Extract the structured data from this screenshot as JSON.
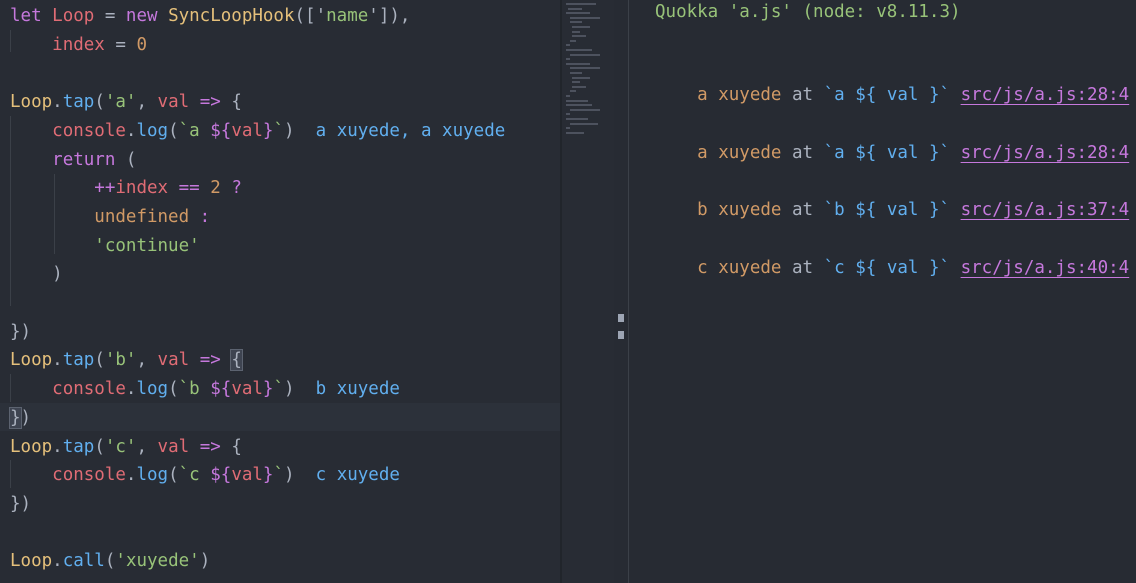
{
  "editor": {
    "lines": [
      {
        "tokens": [
          [
            "kw",
            "let "
          ],
          [
            "var",
            "Loop"
          ],
          [
            "plain",
            " = "
          ],
          [
            "kw",
            "new "
          ],
          [
            "cls",
            "SyncLoopHook"
          ],
          [
            "plain",
            "(['"
          ],
          [
            "str",
            "name"
          ],
          [
            "plain",
            "']),"
          ]
        ]
      },
      {
        "tokens": [
          [
            "plain",
            "    "
          ],
          [
            "var",
            "index"
          ],
          [
            "plain",
            " = "
          ],
          [
            "num",
            "0"
          ]
        ]
      },
      {
        "tokens": []
      },
      {
        "tokens": [
          [
            "cls",
            "Loop"
          ],
          [
            "plain",
            "."
          ],
          [
            "fn",
            "tap"
          ],
          [
            "plain",
            "("
          ],
          [
            "str",
            "'a'"
          ],
          [
            "plain",
            ", "
          ],
          [
            "var",
            "val"
          ],
          [
            "plain",
            " "
          ],
          [
            "op",
            "=>"
          ],
          [
            "plain",
            " {"
          ]
        ]
      },
      {
        "tokens": [
          [
            "plain",
            "    "
          ],
          [
            "var",
            "console"
          ],
          [
            "plain",
            "."
          ],
          [
            "fn",
            "log"
          ],
          [
            "plain",
            "("
          ],
          [
            "str",
            "`a "
          ],
          [
            "tpl",
            "${"
          ],
          [
            "tplvar",
            "val"
          ],
          [
            "tpl",
            "}"
          ],
          [
            "str",
            "`"
          ],
          [
            "plain",
            ")  "
          ],
          [
            "inline-out",
            "a xuyede, a xuyede"
          ]
        ]
      },
      {
        "tokens": [
          [
            "plain",
            "    "
          ],
          [
            "kw",
            "return"
          ],
          [
            "plain",
            " ("
          ]
        ]
      },
      {
        "tokens": [
          [
            "plain",
            "        "
          ],
          [
            "op",
            "++"
          ],
          [
            "var",
            "index"
          ],
          [
            "plain",
            " "
          ],
          [
            "op",
            "=="
          ],
          [
            "plain",
            " "
          ],
          [
            "num",
            "2"
          ],
          [
            "plain",
            " "
          ],
          [
            "op",
            "?"
          ]
        ]
      },
      {
        "tokens": [
          [
            "plain",
            "        "
          ],
          [
            "num",
            "undefined"
          ],
          [
            "plain",
            " "
          ],
          [
            "op",
            ":"
          ]
        ]
      },
      {
        "tokens": [
          [
            "plain",
            "        "
          ],
          [
            "str",
            "'continue'"
          ]
        ]
      },
      {
        "tokens": [
          [
            "plain",
            "    )"
          ]
        ]
      },
      {
        "tokens": []
      },
      {
        "tokens": [
          [
            "plain",
            "})"
          ]
        ]
      },
      {
        "tokens": [
          [
            "cls",
            "Loop"
          ],
          [
            "plain",
            "."
          ],
          [
            "fn",
            "tap"
          ],
          [
            "plain",
            "("
          ],
          [
            "str",
            "'b'"
          ],
          [
            "plain",
            ", "
          ],
          [
            "var",
            "val"
          ],
          [
            "plain",
            " "
          ],
          [
            "op",
            "=>"
          ],
          [
            "plain",
            " "
          ],
          [
            "hl",
            "{"
          ]
        ]
      },
      {
        "tokens": [
          [
            "plain",
            "    "
          ],
          [
            "var",
            "console"
          ],
          [
            "plain",
            "."
          ],
          [
            "fn",
            "log"
          ],
          [
            "plain",
            "("
          ],
          [
            "str",
            "`b "
          ],
          [
            "tpl",
            "${"
          ],
          [
            "tplvar",
            "val"
          ],
          [
            "tpl",
            "}"
          ],
          [
            "str",
            "`"
          ],
          [
            "plain",
            ")  "
          ],
          [
            "inline-out",
            "b xuyede"
          ]
        ]
      },
      {
        "tokens": [
          [
            "hl",
            "}"
          ],
          [
            "plain",
            ")"
          ]
        ]
      },
      {
        "tokens": [
          [
            "cls",
            "Loop"
          ],
          [
            "plain",
            "."
          ],
          [
            "fn",
            "tap"
          ],
          [
            "plain",
            "("
          ],
          [
            "str",
            "'c'"
          ],
          [
            "plain",
            ", "
          ],
          [
            "var",
            "val"
          ],
          [
            "plain",
            " "
          ],
          [
            "op",
            "=>"
          ],
          [
            "plain",
            " {"
          ]
        ]
      },
      {
        "tokens": [
          [
            "plain",
            "    "
          ],
          [
            "var",
            "console"
          ],
          [
            "plain",
            "."
          ],
          [
            "fn",
            "log"
          ],
          [
            "plain",
            "("
          ],
          [
            "str",
            "`c "
          ],
          [
            "tpl",
            "${"
          ],
          [
            "tplvar",
            "val"
          ],
          [
            "tpl",
            "}"
          ],
          [
            "str",
            "`"
          ],
          [
            "plain",
            ")  "
          ],
          [
            "inline-out",
            "c xuyede"
          ]
        ]
      },
      {
        "tokens": [
          [
            "plain",
            "})"
          ]
        ]
      },
      {
        "tokens": []
      },
      {
        "tokens": [
          [
            "cls",
            "Loop"
          ],
          [
            "plain",
            "."
          ],
          [
            "fn",
            "call"
          ],
          [
            "plain",
            "("
          ],
          [
            "str",
            "'xuyede'"
          ],
          [
            "plain",
            ")"
          ]
        ]
      }
    ]
  },
  "output": {
    "header": "Quokka 'a.js' (node: v8.11.3)",
    "entries": [
      {
        "message": "a xuyede",
        "at": "at",
        "expr": "`a ${ val }`",
        "link": "src/js/a.js:28:4"
      },
      {
        "message": "a xuyede",
        "at": "at",
        "expr": "`a ${ val }`",
        "link": "src/js/a.js:28:4"
      },
      {
        "message": "b xuyede",
        "at": "at",
        "expr": "`b ${ val }`",
        "link": "src/js/a.js:37:4"
      },
      {
        "message": "c xuyede",
        "at": "at",
        "expr": "`c ${ val }`",
        "link": "src/js/a.js:40:4"
      }
    ]
  },
  "colors": {
    "background": "#282c34",
    "keyword": "#c678dd",
    "variable": "#e06c75",
    "function": "#61afef",
    "string": "#98c379",
    "number": "#d19a66",
    "class": "#e5c07b"
  }
}
